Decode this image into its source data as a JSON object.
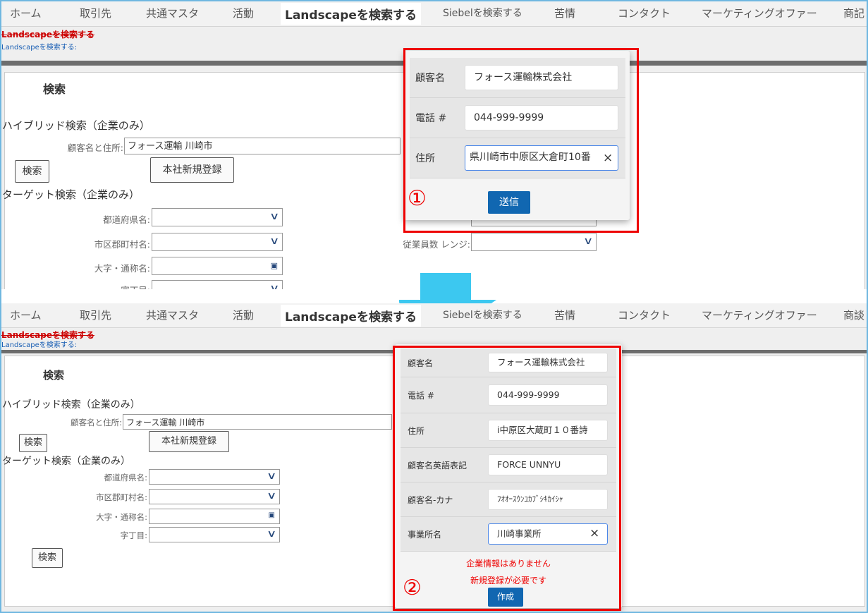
{
  "nav": {
    "items": [
      "ホーム",
      "取引先",
      "共通マスタ",
      "活動",
      "Landscapeを検索する",
      "Siebelを検索する",
      "苦情",
      "コンタクト",
      "マーケティングオファー",
      "商談"
    ],
    "items_cut_top": [
      "ホーム",
      "取引先",
      "共通マスタ",
      "活動",
      "Landscapeを検索する",
      "Siebelを検索する",
      "苦情",
      "コンタクト",
      "マーケティングオファー",
      "商記"
    ],
    "active_index": 4
  },
  "breadcrumb": {
    "title": "Landscapeを検索する",
    "link": "Landscapeを検索する:"
  },
  "page": {
    "search_title": "検索",
    "hybrid_title": "ハイブリッド検索（企業のみ）",
    "hybrid_label": "顧客名と住所:",
    "hybrid_value": "フォース運輸 川崎市",
    "search_button": "検索",
    "register_button": "本社新規登録",
    "target_title": "ターゲット検索（企業のみ）",
    "prefecture_label": "都道府県名:",
    "city_label": "市区郡町村名:",
    "town_label": "大字・通称名:",
    "chome_label": "字丁目:",
    "employee_label": "従業員数 レンジ:"
  },
  "popup1": {
    "name_label": "顧客名",
    "name_value": "フォース運輸株式会社",
    "phone_label": "電話 #",
    "phone_value": "044-999-9999",
    "address_label": "住所",
    "address_value": "県川崎市中原区大倉町10番",
    "submit_button": "送信",
    "step_marker": "①"
  },
  "popup2": {
    "name_label": "顧客名",
    "name_value": "フォース運輸株式会社",
    "phone_label": "電話 #",
    "phone_value": "044-999-9999",
    "address_label": "住所",
    "address_value": "i中原区大蔵町１０番詩",
    "english_label": "顧客名英語表記",
    "english_value": "FORCE UNNYU",
    "kana_label": "顧客名-カナ",
    "kana_value": "ﾌｵｵｰｽｳﾝﾕｶﾌﾞｼｷｶｲｼｬ",
    "office_label": "事業所名",
    "office_value": "川崎事業所",
    "message1": "企業情報はありません",
    "message2": "新規登録が必要です",
    "create_button": "作成",
    "step_marker": "②"
  },
  "icons": {
    "clear": "×",
    "chevron": "∨",
    "lookup": "▣"
  },
  "colors": {
    "annotation_red": "#e00000",
    "arrow_blue": "#3cc8f0",
    "button_blue": "#1167b1"
  }
}
